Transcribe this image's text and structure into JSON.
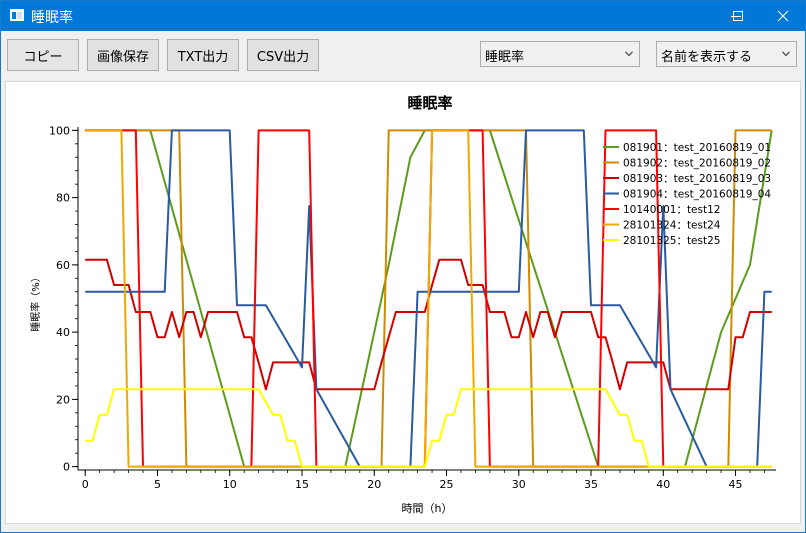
{
  "window": {
    "title": "睡眠率"
  },
  "toolbar": {
    "copy_label": "コピー",
    "save_image_label": "画像保存",
    "txt_label": "TXT出力",
    "csv_label": "CSV出力",
    "metric_select": "睡眠率",
    "name_select": "名前を表示する"
  },
  "chart_data": {
    "type": "line",
    "title": "睡眠率",
    "xlabel": "時間（h）",
    "ylabel": "睡眠率（%）",
    "xlim": [
      -0.5,
      47.8
    ],
    "ylim": [
      -1,
      101
    ],
    "xticks": [
      0,
      5,
      10,
      15,
      20,
      25,
      30,
      35,
      40,
      45
    ],
    "yticks": [
      0,
      20,
      40,
      60,
      80,
      100
    ],
    "grid": false,
    "legend_position": "top-right",
    "series": [
      {
        "name": "081901：test_20160819_01",
        "color": "#5b9b1d",
        "points": [
          [
            0,
            100
          ],
          [
            4.5,
            100
          ],
          [
            11,
            0
          ],
          [
            18,
            0
          ],
          [
            20,
            40
          ],
          [
            21,
            60
          ],
          [
            22.5,
            92
          ],
          [
            23.5,
            100
          ],
          [
            28,
            100
          ],
          [
            35.5,
            0
          ],
          [
            41.5,
            0
          ],
          [
            44,
            40
          ],
          [
            46,
            60
          ],
          [
            47.5,
            100
          ]
        ]
      },
      {
        "name": "081902：test_20160819_02",
        "color": "#d08a00",
        "points": [
          [
            0,
            100
          ],
          [
            6.5,
            100
          ],
          [
            7,
            0
          ],
          [
            20.5,
            0
          ],
          [
            21,
            100
          ],
          [
            30.5,
            100
          ],
          [
            31,
            0
          ],
          [
            44.5,
            0
          ],
          [
            45,
            100
          ],
          [
            47.5,
            100
          ]
        ]
      },
      {
        "name": "081903：test_20160819_03",
        "color": "#d00000",
        "points": [
          [
            0,
            61.5
          ],
          [
            1.5,
            61.5
          ],
          [
            2,
            54
          ],
          [
            3,
            54
          ],
          [
            3.5,
            46
          ],
          [
            4.5,
            46
          ],
          [
            5,
            38.5
          ],
          [
            5.5,
            38.5
          ],
          [
            6,
            46
          ],
          [
            6.5,
            38.5
          ],
          [
            7,
            46
          ],
          [
            7.5,
            46
          ],
          [
            8,
            38.5
          ],
          [
            8.5,
            46
          ],
          [
            10.5,
            46
          ],
          [
            11,
            38.5
          ],
          [
            11.5,
            38.5
          ],
          [
            12,
            31
          ],
          [
            12.5,
            23
          ],
          [
            13,
            31
          ],
          [
            15.5,
            31
          ],
          [
            16,
            23
          ],
          [
            20,
            23
          ],
          [
            20.5,
            31
          ],
          [
            21,
            38.5
          ],
          [
            21.5,
            46
          ],
          [
            23.5,
            46
          ],
          [
            24,
            54
          ],
          [
            24.5,
            61.5
          ],
          [
            26,
            61.5
          ],
          [
            26.5,
            54
          ],
          [
            27.5,
            54
          ],
          [
            28,
            46
          ],
          [
            29,
            46
          ],
          [
            29.5,
            38.5
          ],
          [
            30,
            38.5
          ],
          [
            30.5,
            46
          ],
          [
            31,
            38.5
          ],
          [
            31.5,
            46
          ],
          [
            32,
            46
          ],
          [
            32.5,
            38.5
          ],
          [
            33,
            46
          ],
          [
            35,
            46
          ],
          [
            35.5,
            38.5
          ],
          [
            36,
            38.5
          ],
          [
            36.5,
            31
          ],
          [
            37,
            23
          ],
          [
            37.5,
            31
          ],
          [
            40,
            31
          ],
          [
            40.5,
            23
          ],
          [
            44.5,
            23
          ],
          [
            45,
            38.5
          ],
          [
            45.5,
            38.5
          ],
          [
            46,
            46
          ],
          [
            47.5,
            46
          ]
        ]
      },
      {
        "name": "081904：test_20160819_04",
        "color": "#2a5a9f",
        "points": [
          [
            0,
            52
          ],
          [
            5.5,
            52
          ],
          [
            6,
            100
          ],
          [
            10,
            100
          ],
          [
            10.5,
            48
          ],
          [
            12.5,
            48
          ],
          [
            15,
            29.5
          ],
          [
            15.5,
            77.5
          ],
          [
            16,
            23
          ],
          [
            19,
            0
          ],
          [
            22.5,
            0
          ],
          [
            23,
            52
          ],
          [
            30,
            52
          ],
          [
            30.5,
            100
          ],
          [
            34.5,
            100
          ],
          [
            35,
            48
          ],
          [
            37,
            48
          ],
          [
            39.5,
            29.5
          ],
          [
            40,
            77.5
          ],
          [
            40.5,
            23
          ],
          [
            43,
            0
          ],
          [
            46.5,
            0
          ],
          [
            47,
            52
          ],
          [
            47.5,
            52
          ]
        ]
      },
      {
        "name": "10140001：test12",
        "color": "#ff0000",
        "points": [
          [
            0,
            100
          ],
          [
            3.5,
            100
          ],
          [
            4,
            0
          ],
          [
            11.5,
            0
          ],
          [
            12,
            100
          ],
          [
            15.5,
            100
          ],
          [
            16,
            0
          ],
          [
            23.5,
            0
          ],
          [
            24,
            100
          ],
          [
            27.5,
            100
          ],
          [
            28,
            0
          ],
          [
            35.5,
            0
          ],
          [
            36,
            100
          ],
          [
            39.5,
            100
          ],
          [
            40,
            0
          ],
          [
            47.5,
            0
          ]
        ]
      },
      {
        "name": "28101324：test24",
        "color": "#f0a800",
        "points": [
          [
            0,
            100
          ],
          [
            2.5,
            100
          ],
          [
            3,
            0
          ],
          [
            23.5,
            0
          ],
          [
            24,
            100
          ],
          [
            26.5,
            100
          ],
          [
            27,
            0
          ],
          [
            47.5,
            0
          ]
        ]
      },
      {
        "name": "28101325：test25",
        "color": "#ffff00",
        "points": [
          [
            0,
            7.7
          ],
          [
            0.5,
            7.7
          ],
          [
            1,
            15.4
          ],
          [
            1.5,
            15.4
          ],
          [
            2,
            23
          ],
          [
            12,
            23
          ],
          [
            13,
            15.4
          ],
          [
            13.5,
            15.4
          ],
          [
            14,
            7.7
          ],
          [
            14.5,
            7.7
          ],
          [
            15,
            0
          ],
          [
            23.5,
            0
          ],
          [
            24,
            7.7
          ],
          [
            24.5,
            7.7
          ],
          [
            25,
            15.4
          ],
          [
            25.5,
            15.4
          ],
          [
            26,
            23
          ],
          [
            36,
            23
          ],
          [
            37,
            15.4
          ],
          [
            37.5,
            15.4
          ],
          [
            38,
            7.7
          ],
          [
            38.5,
            7.7
          ],
          [
            39,
            0
          ],
          [
            47.5,
            0
          ]
        ]
      }
    ]
  }
}
